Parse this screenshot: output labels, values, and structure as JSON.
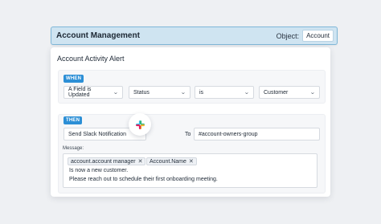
{
  "header": {
    "title": "Account Management",
    "object_label": "Object:",
    "object_value": "Account"
  },
  "card": {
    "title": "Account Activity Alert"
  },
  "when": {
    "tag": "WHEN",
    "trigger": "A Field is Updated",
    "field": "Status",
    "operator": "is",
    "value": "Customer"
  },
  "then": {
    "tag": "THEN",
    "action": "Send Slack Notification",
    "to_label": "To",
    "channel": "#account-owners-group",
    "message_label": "Message:",
    "message_chips": [
      "account.account manager",
      "Account.Name"
    ],
    "message_lines": [
      "Is now a new customer.",
      "Please reach out to schedule their first onboarding meeting."
    ]
  },
  "colors": {
    "accent": "#2c8fd6",
    "header_bg": "#cfe4f1",
    "header_border": "#7fb7d8"
  },
  "icons": [
    "chevron-down-icon",
    "close-icon",
    "slack-icon"
  ]
}
